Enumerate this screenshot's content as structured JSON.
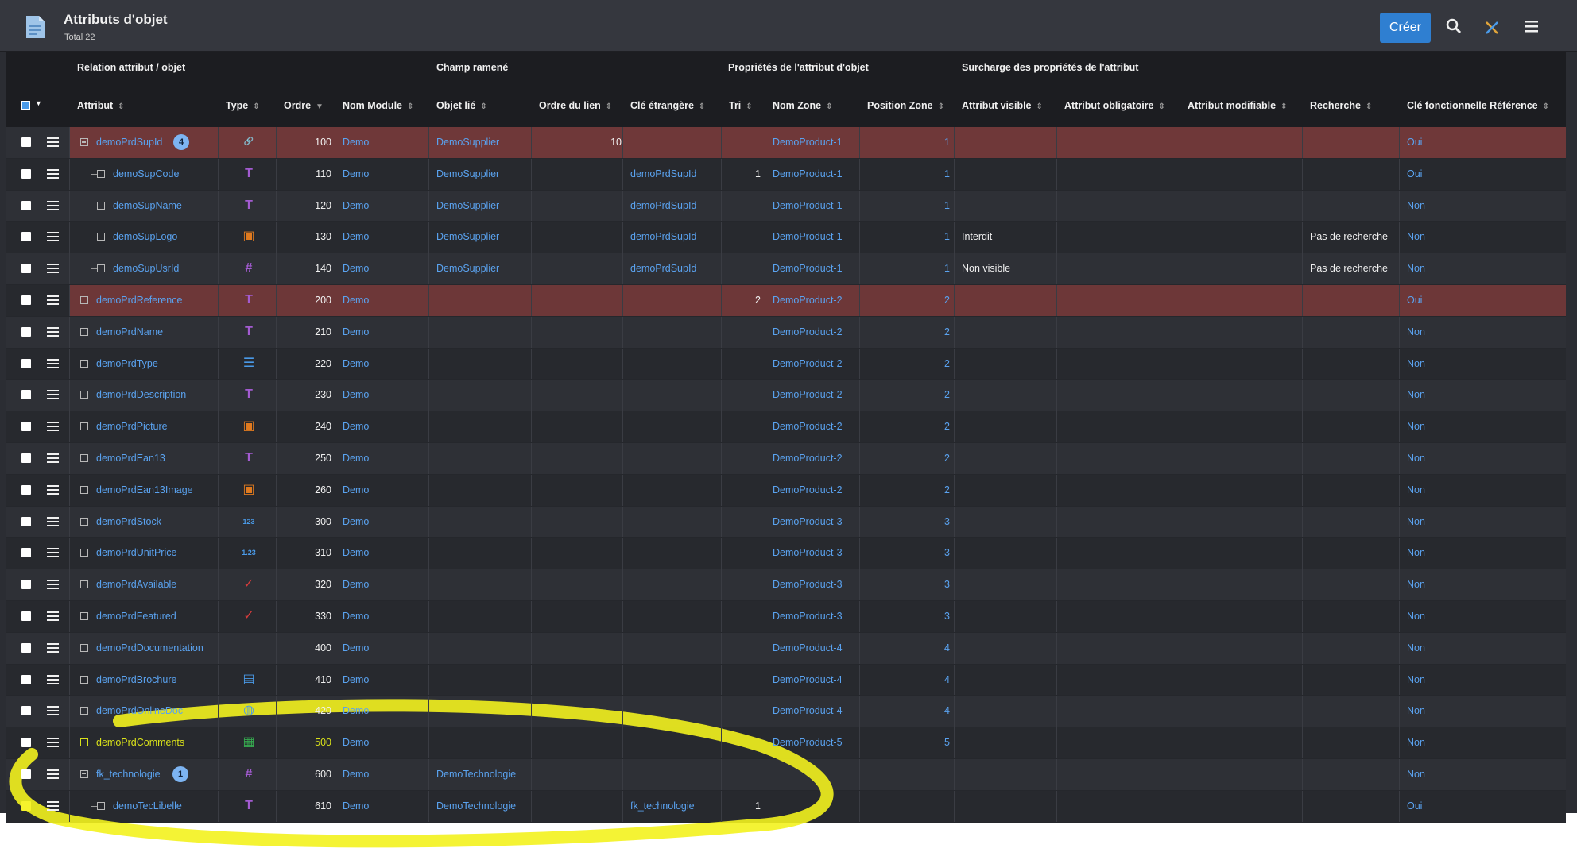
{
  "header": {
    "title": "Attributs d'objet",
    "total": "Total 22",
    "create_label": "Créer"
  },
  "groups": {
    "relation": "Relation attribut / objet",
    "champ": "Champ ramené",
    "proprietes": "Propriétés de l'attribut d'objet",
    "surcharge": "Surcharge des propriétés de l'attribut"
  },
  "columns": {
    "attribut": "Attribut",
    "type": "Type",
    "ordre": "Ordre",
    "nom_module": "Nom Module",
    "objet_lie": "Objet lié",
    "ordre_lien": "Ordre du lien",
    "cle_etrangere": "Clé étrangère",
    "tri": "Tri",
    "nom_zone": "Nom Zone",
    "position_zone": "Position Zone",
    "attribut_visible": "Attribut visible",
    "attribut_obligatoire": "Attribut obligatoire",
    "attribut_modifiable": "Attribut modifiable",
    "recherche": "Recherche",
    "cle_fonctionnelle": "Clé fonctionnelle Référence"
  },
  "rows": [
    {
      "attr": "demoPrdSupId",
      "badge": "4",
      "type": "link",
      "ordre": "100",
      "module": "Demo",
      "objet": "DemoSupplier",
      "ordre_lien": "10",
      "cle": "",
      "tri": "",
      "zone": "DemoProduct-1",
      "pos": "1",
      "visible": "",
      "oblig": "",
      "modif": "",
      "recherche": "",
      "clef": "Oui"
    },
    {
      "attr": "demoSupCode",
      "type": "text-code",
      "ordre": "110",
      "module": "Demo",
      "objet": "DemoSupplier",
      "ordre_lien": "",
      "cle": "demoPrdSupId",
      "tri": "1",
      "zone": "DemoProduct-1",
      "pos": "1",
      "visible": "",
      "oblig": "",
      "modif": "",
      "recherche": "",
      "clef": "Oui"
    },
    {
      "attr": "demoSupName",
      "type": "text",
      "ordre": "120",
      "module": "Demo",
      "objet": "DemoSupplier",
      "ordre_lien": "",
      "cle": "demoPrdSupId",
      "tri": "",
      "zone": "DemoProduct-1",
      "pos": "1",
      "visible": "",
      "oblig": "",
      "modif": "",
      "recherche": "",
      "clef": "Non"
    },
    {
      "attr": "demoSupLogo",
      "type": "image",
      "ordre": "130",
      "module": "Demo",
      "objet": "DemoSupplier",
      "ordre_lien": "",
      "cle": "demoPrdSupId",
      "tri": "",
      "zone": "DemoProduct-1",
      "pos": "1",
      "visible": "Interdit",
      "oblig": "",
      "modif": "",
      "recherche": "Pas de recherche",
      "clef": "Non"
    },
    {
      "attr": "demoSupUsrId",
      "type": "id",
      "ordre": "140",
      "module": "Demo",
      "objet": "DemoSupplier",
      "ordre_lien": "",
      "cle": "demoPrdSupId",
      "tri": "",
      "zone": "DemoProduct-1",
      "pos": "1",
      "visible": "Non visible",
      "oblig": "",
      "modif": "",
      "recherche": "Pas de recherche",
      "clef": "Non"
    },
    {
      "attr": "demoPrdReference",
      "type": "text-code",
      "ordre": "200",
      "module": "Demo",
      "objet": "",
      "ordre_lien": "",
      "cle": "",
      "tri": "2",
      "zone": "DemoProduct-2",
      "pos": "2",
      "visible": "",
      "oblig": "",
      "modif": "",
      "recherche": "",
      "clef": "Oui"
    },
    {
      "attr": "demoPrdName",
      "type": "text",
      "ordre": "210",
      "module": "Demo",
      "objet": "",
      "ordre_lien": "",
      "cle": "",
      "tri": "",
      "zone": "DemoProduct-2",
      "pos": "2",
      "visible": "",
      "oblig": "",
      "modif": "",
      "recherche": "",
      "clef": "Non"
    },
    {
      "attr": "demoPrdType",
      "type": "list",
      "ordre": "220",
      "module": "Demo",
      "objet": "",
      "ordre_lien": "",
      "cle": "",
      "tri": "",
      "zone": "DemoProduct-2",
      "pos": "2",
      "visible": "",
      "oblig": "",
      "modif": "",
      "recherche": "",
      "clef": "Non"
    },
    {
      "attr": "demoPrdDescription",
      "type": "longtext",
      "ordre": "230",
      "module": "Demo",
      "objet": "",
      "ordre_lien": "",
      "cle": "",
      "tri": "",
      "zone": "DemoProduct-2",
      "pos": "2",
      "visible": "",
      "oblig": "",
      "modif": "",
      "recherche": "",
      "clef": "Non"
    },
    {
      "attr": "demoPrdPicture",
      "type": "image",
      "ordre": "240",
      "module": "Demo",
      "objet": "",
      "ordre_lien": "",
      "cle": "",
      "tri": "",
      "zone": "DemoProduct-2",
      "pos": "2",
      "visible": "",
      "oblig": "",
      "modif": "",
      "recherche": "",
      "clef": "Non"
    },
    {
      "attr": "demoPrdEan13",
      "type": "text",
      "ordre": "250",
      "module": "Demo",
      "objet": "",
      "ordre_lien": "",
      "cle": "",
      "tri": "",
      "zone": "DemoProduct-2",
      "pos": "2",
      "visible": "",
      "oblig": "",
      "modif": "",
      "recherche": "",
      "clef": "Non"
    },
    {
      "attr": "demoPrdEan13Image",
      "type": "image",
      "ordre": "260",
      "module": "Demo",
      "objet": "",
      "ordre_lien": "",
      "cle": "",
      "tri": "",
      "zone": "DemoProduct-2",
      "pos": "2",
      "visible": "",
      "oblig": "",
      "modif": "",
      "recherche": "",
      "clef": "Non"
    },
    {
      "attr": "demoPrdStock",
      "type": "int",
      "ordre": "300",
      "module": "Demo",
      "objet": "",
      "ordre_lien": "",
      "cle": "",
      "tri": "",
      "zone": "DemoProduct-3",
      "pos": "3",
      "visible": "",
      "oblig": "",
      "modif": "",
      "recherche": "",
      "clef": "Non"
    },
    {
      "attr": "demoPrdUnitPrice",
      "type": "float",
      "ordre": "310",
      "module": "Demo",
      "objet": "",
      "ordre_lien": "",
      "cle": "",
      "tri": "",
      "zone": "DemoProduct-3",
      "pos": "3",
      "visible": "",
      "oblig": "",
      "modif": "",
      "recherche": "",
      "clef": "Non"
    },
    {
      "attr": "demoPrdAvailable",
      "type": "bool",
      "ordre": "320",
      "module": "Demo",
      "objet": "",
      "ordre_lien": "",
      "cle": "",
      "tri": "",
      "zone": "DemoProduct-3",
      "pos": "3",
      "visible": "",
      "oblig": "",
      "modif": "",
      "recherche": "",
      "clef": "Non"
    },
    {
      "attr": "demoPrdFeatured",
      "type": "bool",
      "ordre": "330",
      "module": "Demo",
      "objet": "",
      "ordre_lien": "",
      "cle": "",
      "tri": "",
      "zone": "DemoProduct-3",
      "pos": "3",
      "visible": "",
      "oblig": "",
      "modif": "",
      "recherche": "",
      "clef": "Non"
    },
    {
      "attr": "demoPrdDocumentation",
      "type": "html",
      "ordre": "400",
      "module": "Demo",
      "objet": "",
      "ordre_lien": "",
      "cle": "",
      "tri": "",
      "zone": "DemoProduct-4",
      "pos": "4",
      "visible": "",
      "oblig": "",
      "modif": "",
      "recherche": "",
      "clef": "Non"
    },
    {
      "attr": "demoPrdBrochure",
      "type": "doc",
      "ordre": "410",
      "module": "Demo",
      "objet": "",
      "ordre_lien": "",
      "cle": "",
      "tri": "",
      "zone": "DemoProduct-4",
      "pos": "4",
      "visible": "",
      "oblig": "",
      "modif": "",
      "recherche": "",
      "clef": "Non"
    },
    {
      "attr": "demoPrdOnlineDoc",
      "type": "url",
      "ordre": "420",
      "module": "Demo",
      "objet": "",
      "ordre_lien": "",
      "cle": "",
      "tri": "",
      "zone": "DemoProduct-4",
      "pos": "4",
      "visible": "",
      "oblig": "",
      "modif": "",
      "recherche": "",
      "clef": "Non"
    },
    {
      "attr": "demoPrdComments",
      "type": "notepad",
      "ordre": "500",
      "module": "Demo",
      "objet": "",
      "ordre_lien": "",
      "cle": "",
      "tri": "",
      "zone": "DemoProduct-5",
      "pos": "5",
      "visible": "",
      "oblig": "",
      "modif": "",
      "recherche": "",
      "clef": "Non"
    },
    {
      "attr": "fk_technologie",
      "badge": "1",
      "type": "id",
      "ordre": "600",
      "module": "Demo",
      "objet": "DemoTechnologie",
      "ordre_lien": "",
      "cle": "",
      "tri": "",
      "zone": "",
      "pos": "",
      "visible": "",
      "oblig": "",
      "modif": "",
      "recherche": "",
      "clef": "Non"
    },
    {
      "attr": "demoTecLibelle",
      "type": "text",
      "ordre": "610",
      "module": "Demo",
      "objet": "DemoTechnologie",
      "ordre_lien": "",
      "cle": "fk_technologie",
      "tri": "1",
      "zone": "",
      "pos": "",
      "visible": "",
      "oblig": "",
      "modif": "",
      "recherche": "",
      "clef": "Oui"
    }
  ]
}
